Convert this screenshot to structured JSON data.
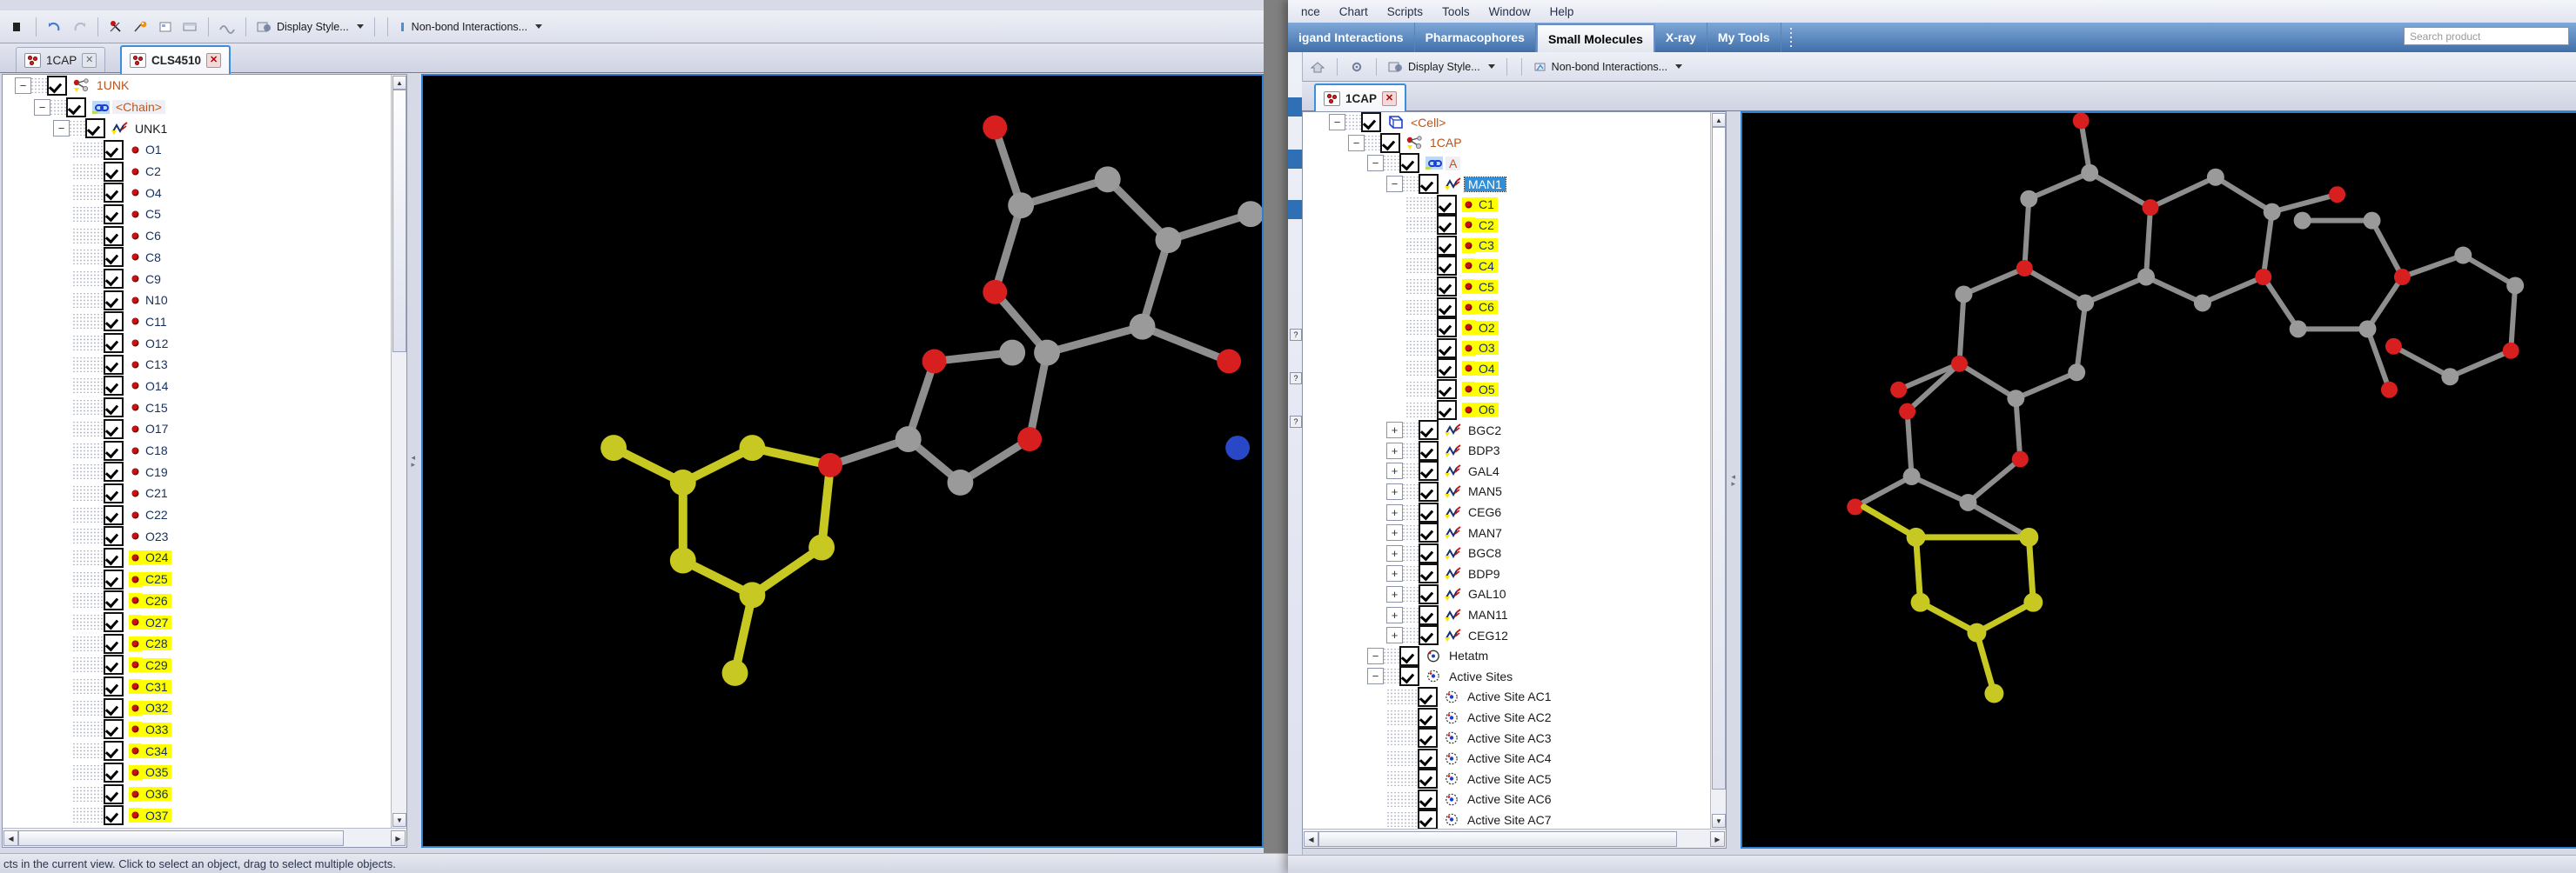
{
  "app": {
    "menu": [
      "nce",
      "Chart",
      "Scripts",
      "Tools",
      "Window",
      "Help"
    ],
    "ribbon_tabs": [
      {
        "label": "igand Interactions",
        "active": false
      },
      {
        "label": "Pharmacophores",
        "active": false
      },
      {
        "label": "Small Molecules",
        "active": true
      },
      {
        "label": "X-ray",
        "active": false
      },
      {
        "label": "My Tools",
        "active": false
      }
    ],
    "search_placeholder": "Search product",
    "statusbar_text": "cts in the current view. Click to select an object, drag to select multiple objects."
  },
  "left_window": {
    "toolbar": {
      "display_style_label": "Display Style...",
      "nonbond_label": "Non-bond Interactions...",
      "icons": [
        "undo-icon",
        "redo-icon",
        "measure-icon",
        "eyedropper-icon",
        "image-icon",
        "window-icon",
        "ribbon-icon",
        "display-style-icon"
      ]
    },
    "tabs": [
      {
        "label": "1CAP",
        "active": false,
        "closable": true
      },
      {
        "label": "CLS4510",
        "active": true,
        "closable": true
      }
    ],
    "tree": [
      {
        "depth": 0,
        "label": "1UNK",
        "icon": "molecule-icon",
        "kind": "molecule",
        "expander": "minus",
        "checked": true
      },
      {
        "depth": 1,
        "label": "<Chain>",
        "icon": "chain-icon",
        "kind": "chain",
        "expander": "minus",
        "checked": true
      },
      {
        "depth": 2,
        "label": "UNK1",
        "icon": "residue-icon",
        "kind": "residue",
        "expander": "minus",
        "checked": true
      },
      {
        "depth": 3,
        "label": "O1",
        "kind": "atom",
        "checked": true,
        "highlight": false
      },
      {
        "depth": 3,
        "label": "C2",
        "kind": "atom",
        "checked": true,
        "highlight": false
      },
      {
        "depth": 3,
        "label": "O4",
        "kind": "atom",
        "checked": true,
        "highlight": false
      },
      {
        "depth": 3,
        "label": "C5",
        "kind": "atom",
        "checked": true,
        "highlight": false
      },
      {
        "depth": 3,
        "label": "C6",
        "kind": "atom",
        "checked": true,
        "highlight": false
      },
      {
        "depth": 3,
        "label": "C8",
        "kind": "atom",
        "checked": true,
        "highlight": false
      },
      {
        "depth": 3,
        "label": "C9",
        "kind": "atom",
        "checked": true,
        "highlight": false
      },
      {
        "depth": 3,
        "label": "N10",
        "kind": "atom",
        "checked": true,
        "highlight": false
      },
      {
        "depth": 3,
        "label": "C11",
        "kind": "atom",
        "checked": true,
        "highlight": false
      },
      {
        "depth": 3,
        "label": "O12",
        "kind": "atom",
        "checked": true,
        "highlight": false
      },
      {
        "depth": 3,
        "label": "C13",
        "kind": "atom",
        "checked": true,
        "highlight": false
      },
      {
        "depth": 3,
        "label": "O14",
        "kind": "atom",
        "checked": true,
        "highlight": false
      },
      {
        "depth": 3,
        "label": "C15",
        "kind": "atom",
        "checked": true,
        "highlight": false
      },
      {
        "depth": 3,
        "label": "O17",
        "kind": "atom",
        "checked": true,
        "highlight": false
      },
      {
        "depth": 3,
        "label": "C18",
        "kind": "atom",
        "checked": true,
        "highlight": false
      },
      {
        "depth": 3,
        "label": "C19",
        "kind": "atom",
        "checked": true,
        "highlight": false
      },
      {
        "depth": 3,
        "label": "C21",
        "kind": "atom",
        "checked": true,
        "highlight": false
      },
      {
        "depth": 3,
        "label": "C22",
        "kind": "atom",
        "checked": true,
        "highlight": false
      },
      {
        "depth": 3,
        "label": "O23",
        "kind": "atom",
        "checked": true,
        "highlight": false
      },
      {
        "depth": 3,
        "label": "O24",
        "kind": "atom",
        "checked": true,
        "highlight": true
      },
      {
        "depth": 3,
        "label": "C25",
        "kind": "atom",
        "checked": true,
        "highlight": true
      },
      {
        "depth": 3,
        "label": "C26",
        "kind": "atom",
        "checked": true,
        "highlight": true
      },
      {
        "depth": 3,
        "label": "O27",
        "kind": "atom",
        "checked": true,
        "highlight": true
      },
      {
        "depth": 3,
        "label": "C28",
        "kind": "atom",
        "checked": true,
        "highlight": true
      },
      {
        "depth": 3,
        "label": "C29",
        "kind": "atom",
        "checked": true,
        "highlight": true
      },
      {
        "depth": 3,
        "label": "C31",
        "kind": "atom",
        "checked": true,
        "highlight": true
      },
      {
        "depth": 3,
        "label": "O32",
        "kind": "atom",
        "checked": true,
        "highlight": true
      },
      {
        "depth": 3,
        "label": "O33",
        "kind": "atom",
        "checked": true,
        "highlight": true
      },
      {
        "depth": 3,
        "label": "C34",
        "kind": "atom",
        "checked": true,
        "highlight": true
      },
      {
        "depth": 3,
        "label": "O35",
        "kind": "atom",
        "checked": true,
        "highlight": true
      },
      {
        "depth": 3,
        "label": "O36",
        "kind": "atom",
        "checked": true,
        "highlight": true
      },
      {
        "depth": 3,
        "label": "O37",
        "kind": "atom",
        "checked": true,
        "highlight": true
      }
    ]
  },
  "right_window": {
    "toolbar": {
      "display_style_label": "Display Style...",
      "nonbond_label": "Non-bond Interactions...",
      "icons": [
        "home-icon",
        "gear-icon",
        "display-style-icon",
        "nonbond-icon"
      ]
    },
    "tabs": [
      {
        "label": "1CAP",
        "active": true,
        "closable": true
      }
    ],
    "tree": [
      {
        "depth": 1,
        "label": "<Cell>",
        "icon": "cell-icon",
        "kind": "cell",
        "expander": "minus",
        "checked": true
      },
      {
        "depth": 2,
        "label": "1CAP",
        "icon": "molecule-icon",
        "kind": "molecule",
        "expander": "minus",
        "checked": true
      },
      {
        "depth": 3,
        "label": "A",
        "icon": "chain-icon",
        "kind": "chain",
        "expander": "minus",
        "checked": true
      },
      {
        "depth": 4,
        "label": "MAN1",
        "icon": "residue-icon",
        "kind": "residue",
        "expander": "minus",
        "checked": true,
        "selected": true
      },
      {
        "depth": 5,
        "label": "C1",
        "kind": "atom",
        "checked": true,
        "highlight": true
      },
      {
        "depth": 5,
        "label": "C2",
        "kind": "atom",
        "checked": true,
        "highlight": true
      },
      {
        "depth": 5,
        "label": "C3",
        "kind": "atom",
        "checked": true,
        "highlight": true
      },
      {
        "depth": 5,
        "label": "C4",
        "kind": "atom",
        "checked": true,
        "highlight": true
      },
      {
        "depth": 5,
        "label": "C5",
        "kind": "atom",
        "checked": true,
        "highlight": true
      },
      {
        "depth": 5,
        "label": "C6",
        "kind": "atom",
        "checked": true,
        "highlight": true
      },
      {
        "depth": 5,
        "label": "O2",
        "kind": "atom",
        "checked": true,
        "highlight": true
      },
      {
        "depth": 5,
        "label": "O3",
        "kind": "atom",
        "checked": true,
        "highlight": true
      },
      {
        "depth": 5,
        "label": "O4",
        "kind": "atom",
        "checked": true,
        "highlight": true
      },
      {
        "depth": 5,
        "label": "O5",
        "kind": "atom",
        "checked": true,
        "highlight": true
      },
      {
        "depth": 5,
        "label": "O6",
        "kind": "atom",
        "checked": true,
        "highlight": true
      },
      {
        "depth": 4,
        "label": "BGC2",
        "icon": "residue-icon",
        "kind": "residue",
        "expander": "plus",
        "checked": true
      },
      {
        "depth": 4,
        "label": "BDP3",
        "icon": "residue-icon",
        "kind": "residue",
        "expander": "plus",
        "checked": true
      },
      {
        "depth": 4,
        "label": "GAL4",
        "icon": "residue-icon",
        "kind": "residue",
        "expander": "plus",
        "checked": true
      },
      {
        "depth": 4,
        "label": "MAN5",
        "icon": "residue-icon",
        "kind": "residue",
        "expander": "plus",
        "checked": true
      },
      {
        "depth": 4,
        "label": "CEG6",
        "icon": "residue-icon",
        "kind": "residue",
        "expander": "plus",
        "checked": true
      },
      {
        "depth": 4,
        "label": "MAN7",
        "icon": "residue-icon",
        "kind": "residue",
        "expander": "plus",
        "checked": true
      },
      {
        "depth": 4,
        "label": "BGC8",
        "icon": "residue-icon",
        "kind": "residue",
        "expander": "plus",
        "checked": true
      },
      {
        "depth": 4,
        "label": "BDP9",
        "icon": "residue-icon",
        "kind": "residue",
        "expander": "plus",
        "checked": true
      },
      {
        "depth": 4,
        "label": "GAL10",
        "icon": "residue-icon",
        "kind": "residue",
        "expander": "plus",
        "checked": true
      },
      {
        "depth": 4,
        "label": "MAN11",
        "icon": "residue-icon",
        "kind": "residue",
        "expander": "plus",
        "checked": true
      },
      {
        "depth": 4,
        "label": "CEG12",
        "icon": "residue-icon",
        "kind": "residue",
        "expander": "plus",
        "checked": true
      },
      {
        "depth": 3,
        "label": "Hetatm",
        "icon": "hetatm-icon",
        "kind": "group",
        "expander": "minus",
        "checked": true
      },
      {
        "depth": 3,
        "label": "Active Sites",
        "icon": "activesite-icon",
        "kind": "group",
        "expander": "minus",
        "checked": false
      },
      {
        "depth": 4,
        "label": "Active Site AC1",
        "icon": "activesite-icon",
        "kind": "site",
        "checked": true
      },
      {
        "depth": 4,
        "label": "Active Site AC2",
        "icon": "activesite-icon",
        "kind": "site",
        "checked": true
      },
      {
        "depth": 4,
        "label": "Active Site AC3",
        "icon": "activesite-icon",
        "kind": "site",
        "checked": true
      },
      {
        "depth": 4,
        "label": "Active Site AC4",
        "icon": "activesite-icon",
        "kind": "site",
        "checked": true
      },
      {
        "depth": 4,
        "label": "Active Site AC5",
        "icon": "activesite-icon",
        "kind": "site",
        "checked": true
      },
      {
        "depth": 4,
        "label": "Active Site AC6",
        "icon": "activesite-icon",
        "kind": "site",
        "checked": true
      },
      {
        "depth": 4,
        "label": "Active Site AC7",
        "icon": "activesite-icon",
        "kind": "site",
        "checked": true
      }
    ]
  },
  "colors": {
    "accent_blue": "#2f8fd8",
    "selection_blue": "#2f8fd8",
    "highlight_yellow": "#ffff00",
    "viewport_background": "#000000",
    "carbon_gray": "#9a9a9a",
    "oxygen_red": "#d81f1f",
    "nitrogen_blue": "#2848c8",
    "ligand_yellow": "#c9c92a",
    "ribbon_blue": "#3f6ea8"
  }
}
